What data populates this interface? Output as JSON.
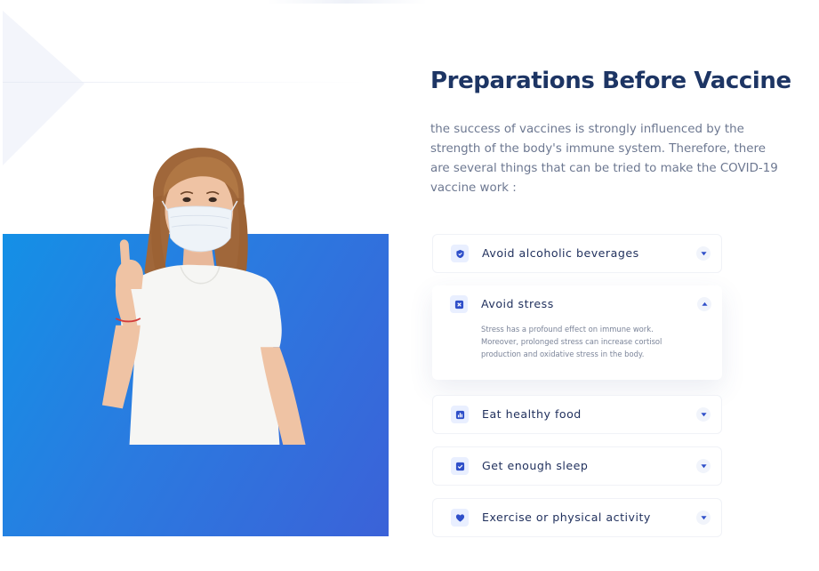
{
  "section": {
    "title": "Preparations Before Vaccine",
    "description": "the success of vaccines is strongly influenced by the strength of the body's immune system. Therefore, there are several things that can be tried to make the COVID-19 vaccine work :"
  },
  "accordion": {
    "items": [
      {
        "label": "Avoid alcoholic beverages",
        "icon": "shield-icon",
        "expanded": false
      },
      {
        "label": "Avoid stress",
        "icon": "close-square-icon",
        "expanded": true,
        "body": "Stress has a profound effect on immune work. Moreover, prolonged stress can increase cortisol production and oxidative stress in the body."
      },
      {
        "label": "Eat healthy food",
        "icon": "chart-icon",
        "expanded": false
      },
      {
        "label": "Get enough sleep",
        "icon": "check-square-icon",
        "expanded": false
      },
      {
        "label": "Exercise or physical activity",
        "icon": "heart-icon",
        "expanded": false
      }
    ]
  },
  "colors": {
    "title": "#1d3564",
    "accent": "#2f4fc9",
    "hero_gradient_start": "#1490e6",
    "hero_gradient_end": "#3b62d8"
  }
}
